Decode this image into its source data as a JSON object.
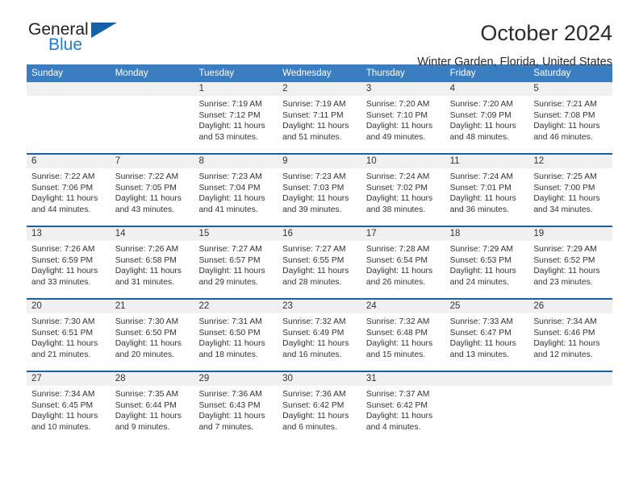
{
  "logo": {
    "text_top": "General",
    "text_bottom": "Blue",
    "triangle": "triangle-mark"
  },
  "header": {
    "title": "October 2024",
    "subtitle": "Winter Garden, Florida, United States"
  },
  "colors": {
    "header_blue": "#3a7dc1",
    "row_divider_blue": "#1f5fa8",
    "day_band_gray": "#f0f0f0",
    "logo_blue": "#1c7fd4",
    "logo_triangle_blue": "#1560a8",
    "text": "#333333"
  },
  "calendar": {
    "weekdays": [
      "Sunday",
      "Monday",
      "Tuesday",
      "Wednesday",
      "Thursday",
      "Friday",
      "Saturday"
    ],
    "labels": {
      "sunrise": "Sunrise:",
      "sunset": "Sunset:",
      "daylight": "Daylight:"
    },
    "weeks": [
      [
        {
          "day": "",
          "empty": true
        },
        {
          "day": "",
          "empty": true
        },
        {
          "day": "1",
          "sunrise": "Sunrise: 7:19 AM",
          "sunset": "Sunset: 7:12 PM",
          "daylight_1": "Daylight: 11 hours",
          "daylight_2": "and 53 minutes."
        },
        {
          "day": "2",
          "sunrise": "Sunrise: 7:19 AM",
          "sunset": "Sunset: 7:11 PM",
          "daylight_1": "Daylight: 11 hours",
          "daylight_2": "and 51 minutes."
        },
        {
          "day": "3",
          "sunrise": "Sunrise: 7:20 AM",
          "sunset": "Sunset: 7:10 PM",
          "daylight_1": "Daylight: 11 hours",
          "daylight_2": "and 49 minutes."
        },
        {
          "day": "4",
          "sunrise": "Sunrise: 7:20 AM",
          "sunset": "Sunset: 7:09 PM",
          "daylight_1": "Daylight: 11 hours",
          "daylight_2": "and 48 minutes."
        },
        {
          "day": "5",
          "sunrise": "Sunrise: 7:21 AM",
          "sunset": "Sunset: 7:08 PM",
          "daylight_1": "Daylight: 11 hours",
          "daylight_2": "and 46 minutes."
        }
      ],
      [
        {
          "day": "6",
          "sunrise": "Sunrise: 7:22 AM",
          "sunset": "Sunset: 7:06 PM",
          "daylight_1": "Daylight: 11 hours",
          "daylight_2": "and 44 minutes."
        },
        {
          "day": "7",
          "sunrise": "Sunrise: 7:22 AM",
          "sunset": "Sunset: 7:05 PM",
          "daylight_1": "Daylight: 11 hours",
          "daylight_2": "and 43 minutes."
        },
        {
          "day": "8",
          "sunrise": "Sunrise: 7:23 AM",
          "sunset": "Sunset: 7:04 PM",
          "daylight_1": "Daylight: 11 hours",
          "daylight_2": "and 41 minutes."
        },
        {
          "day": "9",
          "sunrise": "Sunrise: 7:23 AM",
          "sunset": "Sunset: 7:03 PM",
          "daylight_1": "Daylight: 11 hours",
          "daylight_2": "and 39 minutes."
        },
        {
          "day": "10",
          "sunrise": "Sunrise: 7:24 AM",
          "sunset": "Sunset: 7:02 PM",
          "daylight_1": "Daylight: 11 hours",
          "daylight_2": "and 38 minutes."
        },
        {
          "day": "11",
          "sunrise": "Sunrise: 7:24 AM",
          "sunset": "Sunset: 7:01 PM",
          "daylight_1": "Daylight: 11 hours",
          "daylight_2": "and 36 minutes."
        },
        {
          "day": "12",
          "sunrise": "Sunrise: 7:25 AM",
          "sunset": "Sunset: 7:00 PM",
          "daylight_1": "Daylight: 11 hours",
          "daylight_2": "and 34 minutes."
        }
      ],
      [
        {
          "day": "13",
          "sunrise": "Sunrise: 7:26 AM",
          "sunset": "Sunset: 6:59 PM",
          "daylight_1": "Daylight: 11 hours",
          "daylight_2": "and 33 minutes."
        },
        {
          "day": "14",
          "sunrise": "Sunrise: 7:26 AM",
          "sunset": "Sunset: 6:58 PM",
          "daylight_1": "Daylight: 11 hours",
          "daylight_2": "and 31 minutes."
        },
        {
          "day": "15",
          "sunrise": "Sunrise: 7:27 AM",
          "sunset": "Sunset: 6:57 PM",
          "daylight_1": "Daylight: 11 hours",
          "daylight_2": "and 29 minutes."
        },
        {
          "day": "16",
          "sunrise": "Sunrise: 7:27 AM",
          "sunset": "Sunset: 6:55 PM",
          "daylight_1": "Daylight: 11 hours",
          "daylight_2": "and 28 minutes."
        },
        {
          "day": "17",
          "sunrise": "Sunrise: 7:28 AM",
          "sunset": "Sunset: 6:54 PM",
          "daylight_1": "Daylight: 11 hours",
          "daylight_2": "and 26 minutes."
        },
        {
          "day": "18",
          "sunrise": "Sunrise: 7:29 AM",
          "sunset": "Sunset: 6:53 PM",
          "daylight_1": "Daylight: 11 hours",
          "daylight_2": "and 24 minutes."
        },
        {
          "day": "19",
          "sunrise": "Sunrise: 7:29 AM",
          "sunset": "Sunset: 6:52 PM",
          "daylight_1": "Daylight: 11 hours",
          "daylight_2": "and 23 minutes."
        }
      ],
      [
        {
          "day": "20",
          "sunrise": "Sunrise: 7:30 AM",
          "sunset": "Sunset: 6:51 PM",
          "daylight_1": "Daylight: 11 hours",
          "daylight_2": "and 21 minutes."
        },
        {
          "day": "21",
          "sunrise": "Sunrise: 7:30 AM",
          "sunset": "Sunset: 6:50 PM",
          "daylight_1": "Daylight: 11 hours",
          "daylight_2": "and 20 minutes."
        },
        {
          "day": "22",
          "sunrise": "Sunrise: 7:31 AM",
          "sunset": "Sunset: 6:50 PM",
          "daylight_1": "Daylight: 11 hours",
          "daylight_2": "and 18 minutes."
        },
        {
          "day": "23",
          "sunrise": "Sunrise: 7:32 AM",
          "sunset": "Sunset: 6:49 PM",
          "daylight_1": "Daylight: 11 hours",
          "daylight_2": "and 16 minutes."
        },
        {
          "day": "24",
          "sunrise": "Sunrise: 7:32 AM",
          "sunset": "Sunset: 6:48 PM",
          "daylight_1": "Daylight: 11 hours",
          "daylight_2": "and 15 minutes."
        },
        {
          "day": "25",
          "sunrise": "Sunrise: 7:33 AM",
          "sunset": "Sunset: 6:47 PM",
          "daylight_1": "Daylight: 11 hours",
          "daylight_2": "and 13 minutes."
        },
        {
          "day": "26",
          "sunrise": "Sunrise: 7:34 AM",
          "sunset": "Sunset: 6:46 PM",
          "daylight_1": "Daylight: 11 hours",
          "daylight_2": "and 12 minutes."
        }
      ],
      [
        {
          "day": "27",
          "sunrise": "Sunrise: 7:34 AM",
          "sunset": "Sunset: 6:45 PM",
          "daylight_1": "Daylight: 11 hours",
          "daylight_2": "and 10 minutes."
        },
        {
          "day": "28",
          "sunrise": "Sunrise: 7:35 AM",
          "sunset": "Sunset: 6:44 PM",
          "daylight_1": "Daylight: 11 hours",
          "daylight_2": "and 9 minutes."
        },
        {
          "day": "29",
          "sunrise": "Sunrise: 7:36 AM",
          "sunset": "Sunset: 6:43 PM",
          "daylight_1": "Daylight: 11 hours",
          "daylight_2": "and 7 minutes."
        },
        {
          "day": "30",
          "sunrise": "Sunrise: 7:36 AM",
          "sunset": "Sunset: 6:42 PM",
          "daylight_1": "Daylight: 11 hours",
          "daylight_2": "and 6 minutes."
        },
        {
          "day": "31",
          "sunrise": "Sunrise: 7:37 AM",
          "sunset": "Sunset: 6:42 PM",
          "daylight_1": "Daylight: 11 hours",
          "daylight_2": "and 4 minutes."
        },
        {
          "day": "",
          "empty": true
        },
        {
          "day": "",
          "empty": true
        }
      ]
    ]
  }
}
